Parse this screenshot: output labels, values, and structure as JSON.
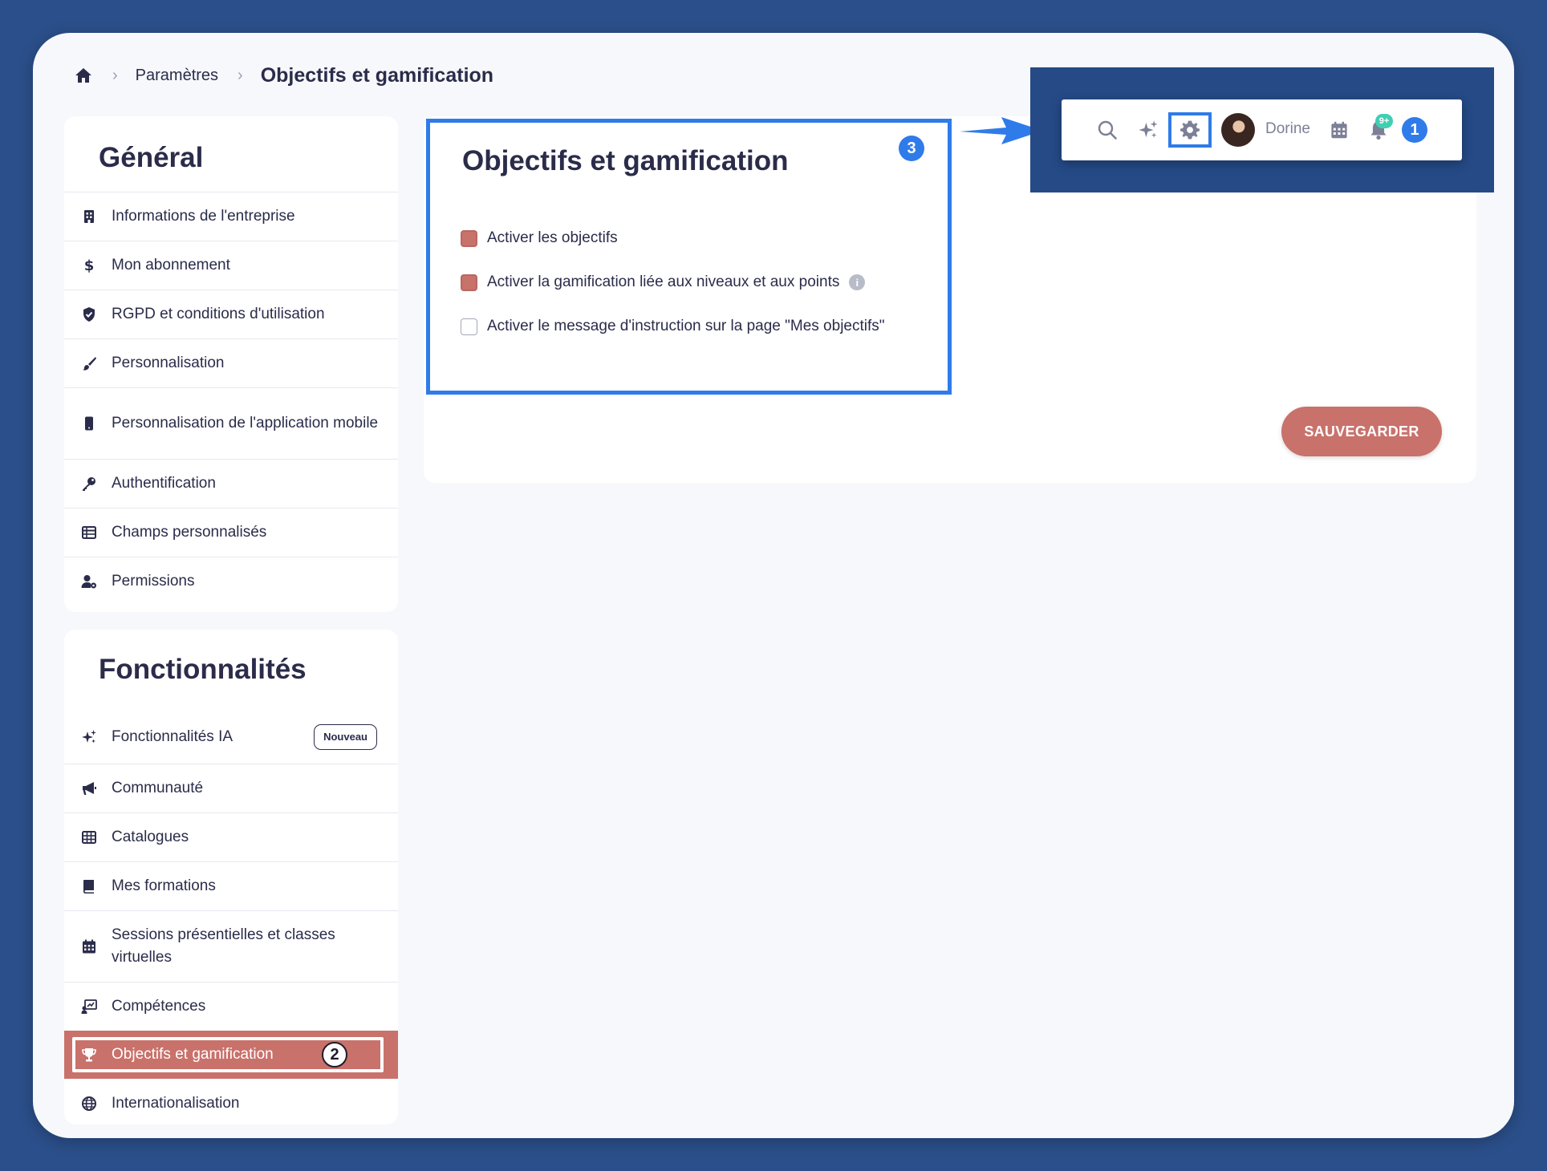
{
  "breadcrumb": {
    "icon": "home-icon",
    "items": [
      "Paramètres",
      "Objectifs et gamification"
    ]
  },
  "sidebar": {
    "general": {
      "title": "Général",
      "items": [
        {
          "icon": "building-icon",
          "label": "Informations de l'entreprise"
        },
        {
          "icon": "dollar-icon",
          "label": "Mon abonnement"
        },
        {
          "icon": "shield-icon",
          "label": "RGPD et conditions d'utilisation"
        },
        {
          "icon": "brush-icon",
          "label": "Personnalisation"
        },
        {
          "icon": "mobile-icon",
          "label": "Personnalisation de l'application mobile"
        },
        {
          "icon": "key-icon",
          "label": "Authentification"
        },
        {
          "icon": "table-icon",
          "label": "Champs personnalisés"
        },
        {
          "icon": "user-gear-icon",
          "label": "Permissions"
        }
      ]
    },
    "features": {
      "title": "Fonctionnalités",
      "items": [
        {
          "icon": "sparkles-icon",
          "label": "Fonctionnalités IA",
          "badge": "Nouveau"
        },
        {
          "icon": "megaphone-icon",
          "label": "Communauté"
        },
        {
          "icon": "grid-icon",
          "label": "Catalogues"
        },
        {
          "icon": "book-icon",
          "label": "Mes formations"
        },
        {
          "icon": "calendar-icon",
          "label": "Sessions présentielles et classes virtuelles"
        },
        {
          "icon": "chart-board-icon",
          "label": "Compétences"
        },
        {
          "icon": "trophy-icon",
          "label": "Objectifs et gamification",
          "active": true,
          "step": "2"
        },
        {
          "icon": "globe-icon",
          "label": "Internationalisation"
        }
      ]
    }
  },
  "main": {
    "title": "Objectifs et gamification",
    "step": "3",
    "options": [
      {
        "label": "Activer les objectifs",
        "checked": true
      },
      {
        "label": "Activer la gamification liée aux niveaux et aux points",
        "checked": true,
        "info": "i"
      },
      {
        "label": "Activer le message d'instruction sur la page \"Mes objectifs\"",
        "checked": false
      }
    ],
    "save_label": "SAUVEGARDER"
  },
  "header": {
    "user_name": "Dorine",
    "notifications": "9+",
    "step": "1",
    "icons": [
      "search-icon",
      "sparkles-icon",
      "gear-icon",
      "avatar",
      "calendar-icon",
      "bell-icon"
    ]
  },
  "colors": {
    "background": "#2b4f8a",
    "accent": "#c9716b",
    "highlight": "#2f7bea",
    "text": "#2a2c4a",
    "notification": "#3fcfb2"
  }
}
